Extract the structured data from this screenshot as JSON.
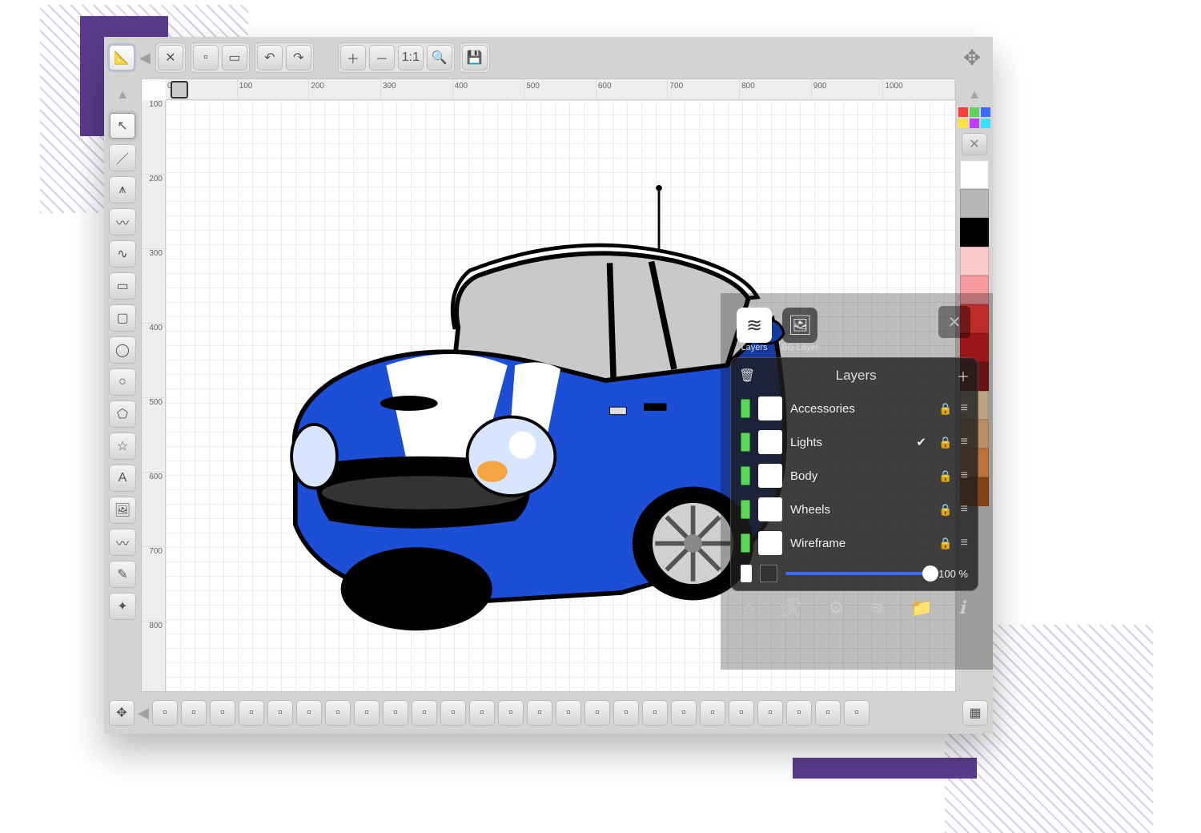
{
  "ruler": {
    "ticks_h": [
      "0",
      "100",
      "200",
      "300",
      "400",
      "500",
      "600",
      "700",
      "800",
      "900",
      "1000"
    ],
    "ticks_v": [
      "100",
      "200",
      "300",
      "400",
      "500",
      "600",
      "700",
      "800"
    ]
  },
  "layers_panel": {
    "tab_layers": "Layers",
    "tab_bg": "BG Layer",
    "title": "Layers",
    "layers": [
      {
        "name": "Accessories",
        "selected": false
      },
      {
        "name": "Lights",
        "selected": true
      },
      {
        "name": "Body",
        "selected": false
      },
      {
        "name": "Wheels",
        "selected": false
      },
      {
        "name": "Wireframe",
        "selected": false
      }
    ],
    "opacity_label": "100 %"
  },
  "palette": [
    "#ffffff",
    "#b8b8b8",
    "#000000",
    "#f9c9cc",
    "#f79aa0",
    "#ff3b3b",
    "#d21f1f",
    "#8a1a1a",
    "#ffd9b3",
    "#ffbe85",
    "#ff9a4d",
    "#b45a1f"
  ],
  "palette_mini": [
    "#ff3b3b",
    "#5bd65b",
    "#3b6bff",
    "#ffe23b",
    "#c23bff",
    "#3be0ff"
  ],
  "icons": {
    "close": "✕",
    "undo": "↶",
    "redo": "↷",
    "zoom_in": "＋",
    "zoom_out": "－",
    "zoom_fit": "1:1",
    "zoom_sel": "🔍",
    "save": "💾",
    "pointer": "↖",
    "line": "／",
    "polyline": "⩚",
    "curve": "〰",
    "bezier": "∿",
    "rect": "▭",
    "roundrect": "▢",
    "ellipse": "◯",
    "circle": "○",
    "polygon": "⬠",
    "star": "☆",
    "text": "A",
    "image": "🖼",
    "pencil": "〰",
    "pen": "✎",
    "path": "✦",
    "home": "⌂",
    "tools": "🛠",
    "gear": "⚙",
    "layers": "≋",
    "folder": "📁",
    "info": "ℹ",
    "trash": "🗑",
    "plus": "＋",
    "move": "✥",
    "nav": "✥",
    "grid": "▦",
    "lock": "🔒",
    "list": "≡",
    "check": "✔",
    "bg": "🖼"
  }
}
